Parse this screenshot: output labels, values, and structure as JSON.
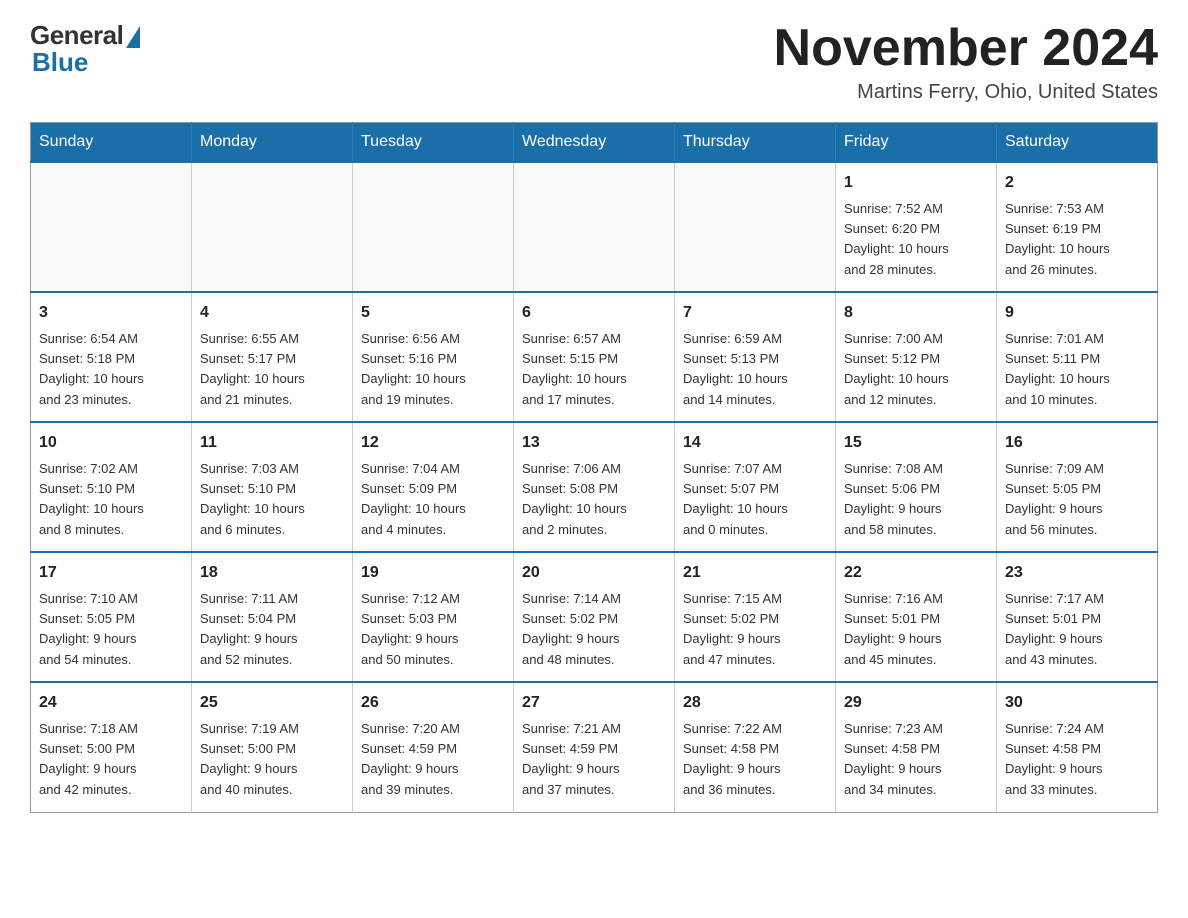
{
  "logo": {
    "general": "General",
    "blue": "Blue"
  },
  "title": {
    "month": "November 2024",
    "location": "Martins Ferry, Ohio, United States"
  },
  "weekdays": [
    "Sunday",
    "Monday",
    "Tuesday",
    "Wednesday",
    "Thursday",
    "Friday",
    "Saturday"
  ],
  "weeks": [
    [
      {
        "day": "",
        "info": ""
      },
      {
        "day": "",
        "info": ""
      },
      {
        "day": "",
        "info": ""
      },
      {
        "day": "",
        "info": ""
      },
      {
        "day": "",
        "info": ""
      },
      {
        "day": "1",
        "info": "Sunrise: 7:52 AM\nSunset: 6:20 PM\nDaylight: 10 hours\nand 28 minutes."
      },
      {
        "day": "2",
        "info": "Sunrise: 7:53 AM\nSunset: 6:19 PM\nDaylight: 10 hours\nand 26 minutes."
      }
    ],
    [
      {
        "day": "3",
        "info": "Sunrise: 6:54 AM\nSunset: 5:18 PM\nDaylight: 10 hours\nand 23 minutes."
      },
      {
        "day": "4",
        "info": "Sunrise: 6:55 AM\nSunset: 5:17 PM\nDaylight: 10 hours\nand 21 minutes."
      },
      {
        "day": "5",
        "info": "Sunrise: 6:56 AM\nSunset: 5:16 PM\nDaylight: 10 hours\nand 19 minutes."
      },
      {
        "day": "6",
        "info": "Sunrise: 6:57 AM\nSunset: 5:15 PM\nDaylight: 10 hours\nand 17 minutes."
      },
      {
        "day": "7",
        "info": "Sunrise: 6:59 AM\nSunset: 5:13 PM\nDaylight: 10 hours\nand 14 minutes."
      },
      {
        "day": "8",
        "info": "Sunrise: 7:00 AM\nSunset: 5:12 PM\nDaylight: 10 hours\nand 12 minutes."
      },
      {
        "day": "9",
        "info": "Sunrise: 7:01 AM\nSunset: 5:11 PM\nDaylight: 10 hours\nand 10 minutes."
      }
    ],
    [
      {
        "day": "10",
        "info": "Sunrise: 7:02 AM\nSunset: 5:10 PM\nDaylight: 10 hours\nand 8 minutes."
      },
      {
        "day": "11",
        "info": "Sunrise: 7:03 AM\nSunset: 5:10 PM\nDaylight: 10 hours\nand 6 minutes."
      },
      {
        "day": "12",
        "info": "Sunrise: 7:04 AM\nSunset: 5:09 PM\nDaylight: 10 hours\nand 4 minutes."
      },
      {
        "day": "13",
        "info": "Sunrise: 7:06 AM\nSunset: 5:08 PM\nDaylight: 10 hours\nand 2 minutes."
      },
      {
        "day": "14",
        "info": "Sunrise: 7:07 AM\nSunset: 5:07 PM\nDaylight: 10 hours\nand 0 minutes."
      },
      {
        "day": "15",
        "info": "Sunrise: 7:08 AM\nSunset: 5:06 PM\nDaylight: 9 hours\nand 58 minutes."
      },
      {
        "day": "16",
        "info": "Sunrise: 7:09 AM\nSunset: 5:05 PM\nDaylight: 9 hours\nand 56 minutes."
      }
    ],
    [
      {
        "day": "17",
        "info": "Sunrise: 7:10 AM\nSunset: 5:05 PM\nDaylight: 9 hours\nand 54 minutes."
      },
      {
        "day": "18",
        "info": "Sunrise: 7:11 AM\nSunset: 5:04 PM\nDaylight: 9 hours\nand 52 minutes."
      },
      {
        "day": "19",
        "info": "Sunrise: 7:12 AM\nSunset: 5:03 PM\nDaylight: 9 hours\nand 50 minutes."
      },
      {
        "day": "20",
        "info": "Sunrise: 7:14 AM\nSunset: 5:02 PM\nDaylight: 9 hours\nand 48 minutes."
      },
      {
        "day": "21",
        "info": "Sunrise: 7:15 AM\nSunset: 5:02 PM\nDaylight: 9 hours\nand 47 minutes."
      },
      {
        "day": "22",
        "info": "Sunrise: 7:16 AM\nSunset: 5:01 PM\nDaylight: 9 hours\nand 45 minutes."
      },
      {
        "day": "23",
        "info": "Sunrise: 7:17 AM\nSunset: 5:01 PM\nDaylight: 9 hours\nand 43 minutes."
      }
    ],
    [
      {
        "day": "24",
        "info": "Sunrise: 7:18 AM\nSunset: 5:00 PM\nDaylight: 9 hours\nand 42 minutes."
      },
      {
        "day": "25",
        "info": "Sunrise: 7:19 AM\nSunset: 5:00 PM\nDaylight: 9 hours\nand 40 minutes."
      },
      {
        "day": "26",
        "info": "Sunrise: 7:20 AM\nSunset: 4:59 PM\nDaylight: 9 hours\nand 39 minutes."
      },
      {
        "day": "27",
        "info": "Sunrise: 7:21 AM\nSunset: 4:59 PM\nDaylight: 9 hours\nand 37 minutes."
      },
      {
        "day": "28",
        "info": "Sunrise: 7:22 AM\nSunset: 4:58 PM\nDaylight: 9 hours\nand 36 minutes."
      },
      {
        "day": "29",
        "info": "Sunrise: 7:23 AM\nSunset: 4:58 PM\nDaylight: 9 hours\nand 34 minutes."
      },
      {
        "day": "30",
        "info": "Sunrise: 7:24 AM\nSunset: 4:58 PM\nDaylight: 9 hours\nand 33 minutes."
      }
    ]
  ]
}
